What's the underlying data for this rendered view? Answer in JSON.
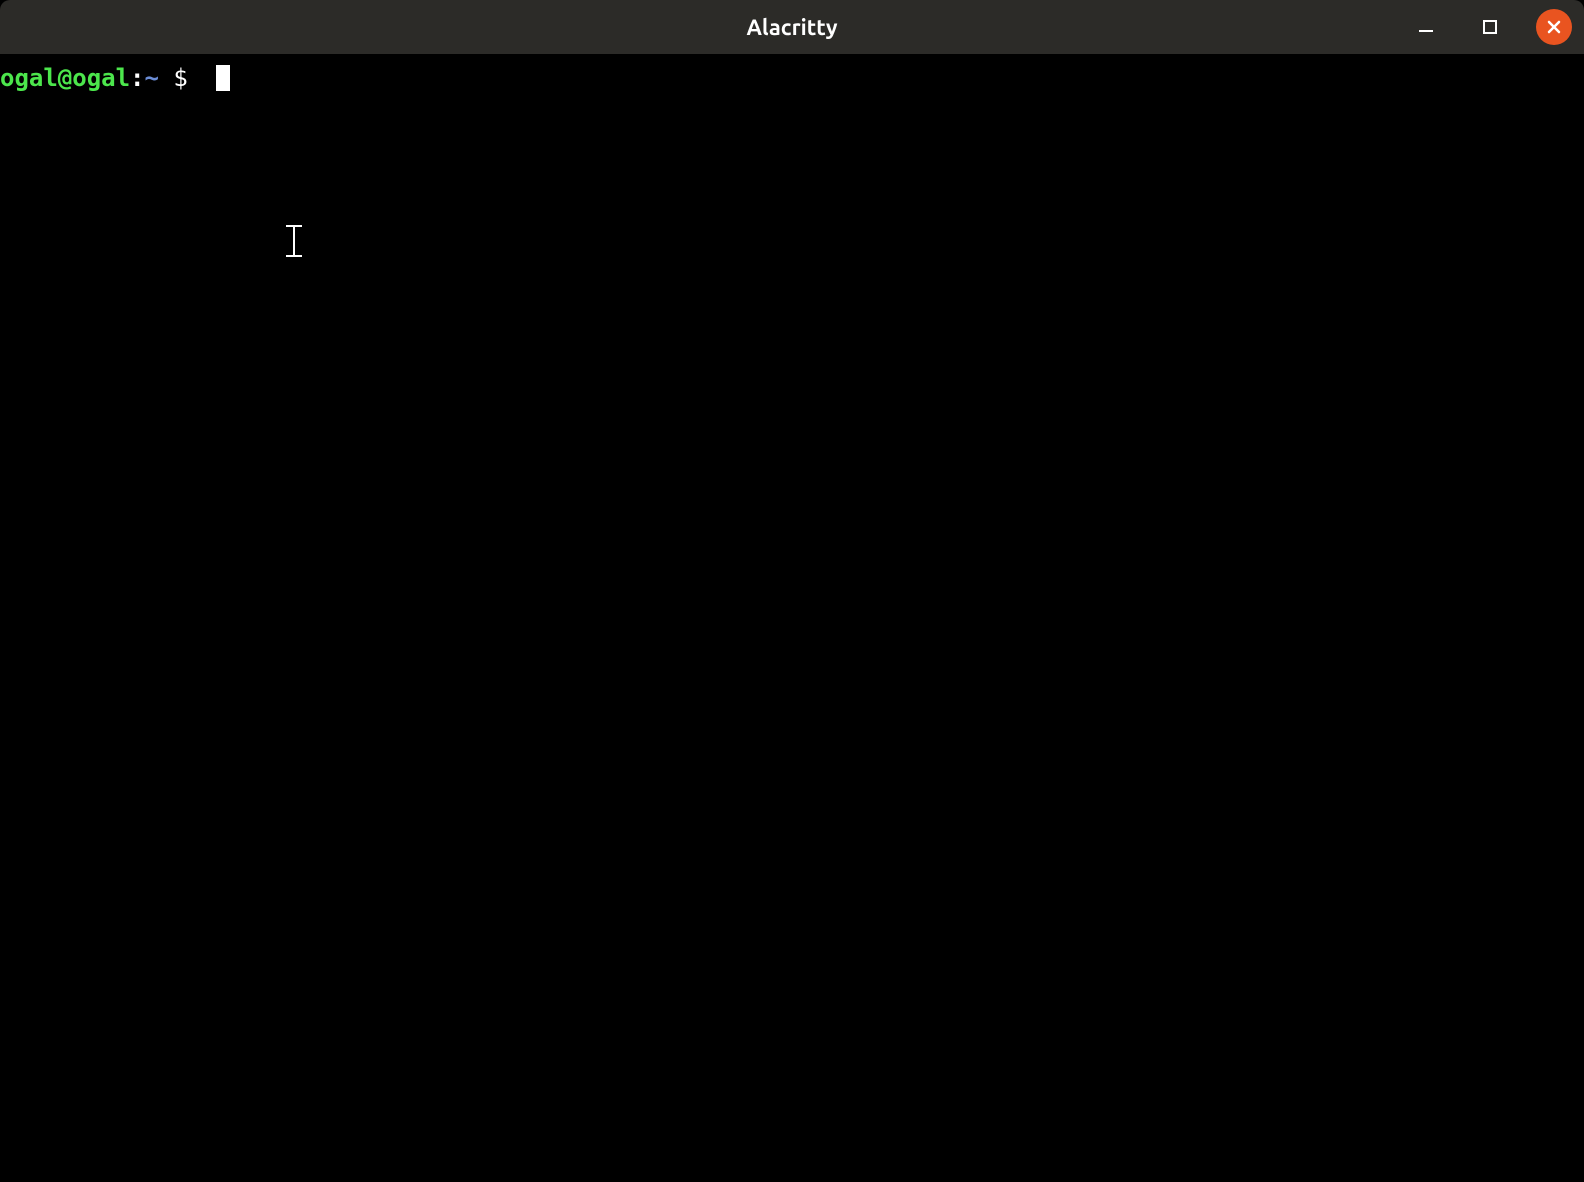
{
  "window": {
    "title": "Alacritty"
  },
  "terminal": {
    "prompt": {
      "user_host": "ogal@ogal",
      "separator": ":",
      "cwd": "~",
      "symbol": " $ "
    }
  },
  "colors": {
    "titlebar_bg": "#2c2b28",
    "terminal_bg": "#000000",
    "prompt_user": "#4ce64c",
    "prompt_cwd": "#6b8dd6",
    "prompt_text": "#ffffff",
    "close_btn": "#e95420"
  }
}
